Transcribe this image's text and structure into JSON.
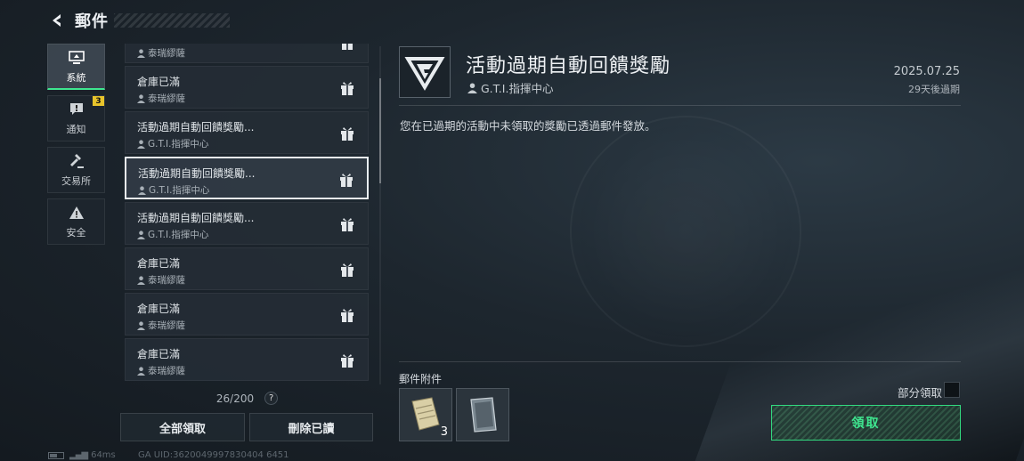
{
  "header": {
    "title": "郵件"
  },
  "sidebar": {
    "tabs": [
      {
        "label": "系統",
        "icon": "monitor-icon",
        "active": true
      },
      {
        "label": "通知",
        "icon": "alert-message-icon",
        "badge": "3"
      },
      {
        "label": "交易所",
        "icon": "hammer-icon"
      },
      {
        "label": "安全",
        "icon": "warning-icon"
      }
    ]
  },
  "mail_list": {
    "items": [
      {
        "title": "",
        "sender": "泰瑞繆薩"
      },
      {
        "title": "倉庫已滿",
        "sender": "泰瑞繆薩"
      },
      {
        "title": "活動過期自動回饋獎勵...",
        "sender": "G.T.I.指揮中心"
      },
      {
        "title": "活動過期自動回饋獎勵...",
        "sender": "G.T.I.指揮中心",
        "selected": true
      },
      {
        "title": "活動過期自動回饋獎勵...",
        "sender": "G.T.I.指揮中心"
      },
      {
        "title": "倉庫已滿",
        "sender": "泰瑞繆薩"
      },
      {
        "title": "倉庫已滿",
        "sender": "泰瑞繆薩"
      },
      {
        "title": "倉庫已滿",
        "sender": "泰瑞繆薩"
      }
    ],
    "count": "26/200",
    "help": "?",
    "claim_all_label": "全部領取",
    "delete_read_label": "刪除已讀"
  },
  "status_bar": {
    "ping": "64ms",
    "uid": "GA UID:3620049997830404 6451"
  },
  "detail": {
    "title": "活動過期自動回饋獎勵",
    "sender": "G.T.I.指揮中心",
    "date": "2025.07.25",
    "expire": "29天後過期",
    "body": "您在已過期的活動中未領取的獎勵已透過郵件發放。",
    "attachments_label": "郵件附件",
    "attachments": [
      {
        "icon": "paper-scroll-icon",
        "quantity": "3"
      },
      {
        "icon": "metal-plate-icon",
        "quantity": ""
      }
    ],
    "partial_claim_label": "部分領取",
    "claim_label": "領取"
  },
  "colors": {
    "accent": "#3ee68f",
    "badge": "#e8c42b"
  }
}
